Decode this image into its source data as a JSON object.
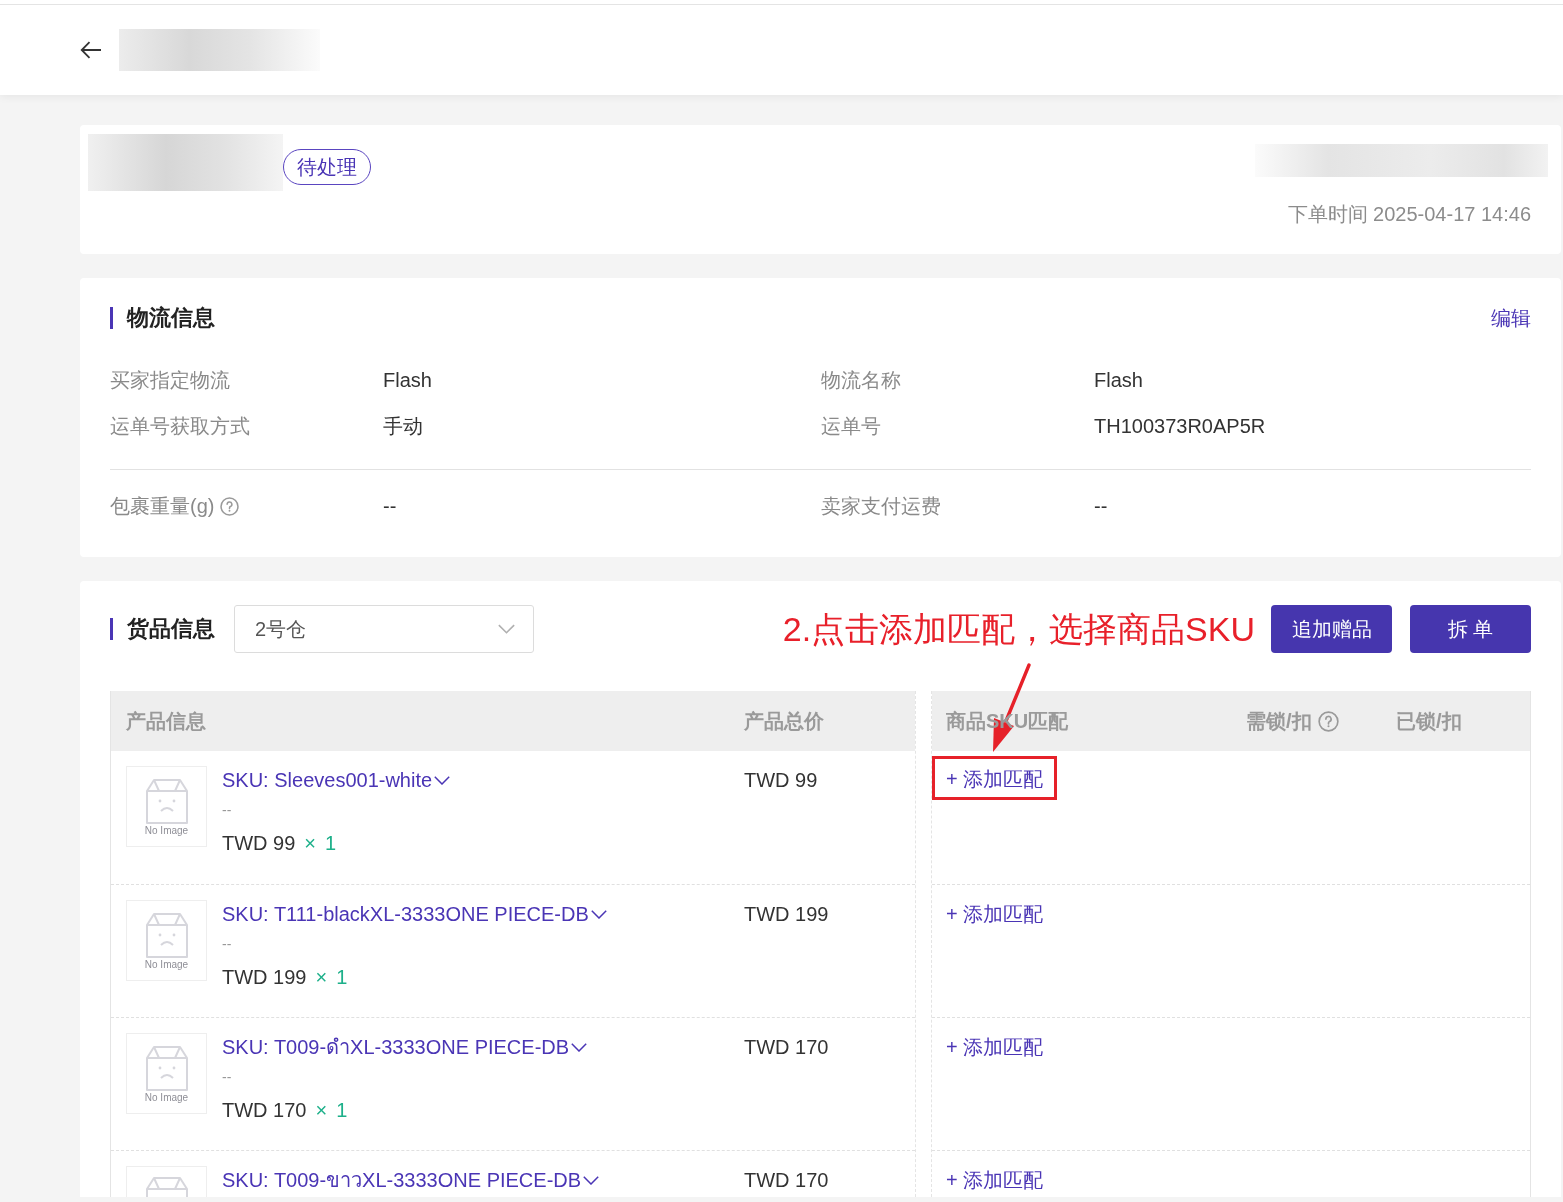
{
  "order": {
    "status": "待处理",
    "time_label": "下单时间",
    "time": "2025-04-17 14:46"
  },
  "logistics": {
    "title": "物流信息",
    "edit": "编辑",
    "groups": [
      [
        {
          "label": "买家指定物流",
          "value": "Flash",
          "help": false
        },
        {
          "label": "物流名称",
          "value": "Flash",
          "help": false
        },
        {
          "label": "运单号获取方式",
          "value": "手动",
          "help": false
        },
        {
          "label": "运单号",
          "value": "TH100373R0AP5R",
          "help": false
        }
      ],
      [
        {
          "label": "包裹重量(g)",
          "value": "--",
          "help": true
        },
        {
          "label": "卖家支付运费",
          "value": "--",
          "help": false
        }
      ]
    ]
  },
  "goods": {
    "title": "货品信息",
    "warehouse": {
      "value": "2号仓"
    },
    "annotation": "2.点击添加匹配，选择商品SKU",
    "buttons": [
      "追加赠品",
      "拆 单"
    ],
    "table": {
      "product_columns": [
        {
          "label": "产品信息"
        },
        {
          "label": "产品总价"
        }
      ],
      "match_columns": [
        {
          "label": "商品SKU匹配",
          "help": false
        },
        {
          "label": "需锁/扣",
          "help": true
        },
        {
          "label": "已锁/扣",
          "help": false
        }
      ],
      "rows": [
        {
          "sku": "SKU: Sleeves001-white",
          "image_label": "No Image",
          "note": "--",
          "unit_price": "TWD 99",
          "times": "×",
          "qty": "1",
          "total": "TWD 99",
          "match": "+ 添加匹配",
          "highlighted": true
        },
        {
          "sku": "SKU: T111-blackXL-3333ONE PIECE-DB",
          "image_label": "No Image",
          "note": "--",
          "unit_price": "TWD 199",
          "times": "×",
          "qty": "1",
          "total": "TWD 199",
          "match": "+ 添加匹配",
          "highlighted": false
        },
        {
          "sku": "SKU: T009-ดำXL-3333ONE PIECE-DB",
          "image_label": "No Image",
          "note": "--",
          "unit_price": "TWD 170",
          "times": "×",
          "qty": "1",
          "total": "TWD 170",
          "match": "+ 添加匹配",
          "highlighted": false
        },
        {
          "sku": "SKU: T009-ขาวXL-3333ONE PIECE-DB",
          "total": "TWD 170",
          "match": "+ 添加匹配",
          "highlighted": false
        }
      ]
    }
  }
}
